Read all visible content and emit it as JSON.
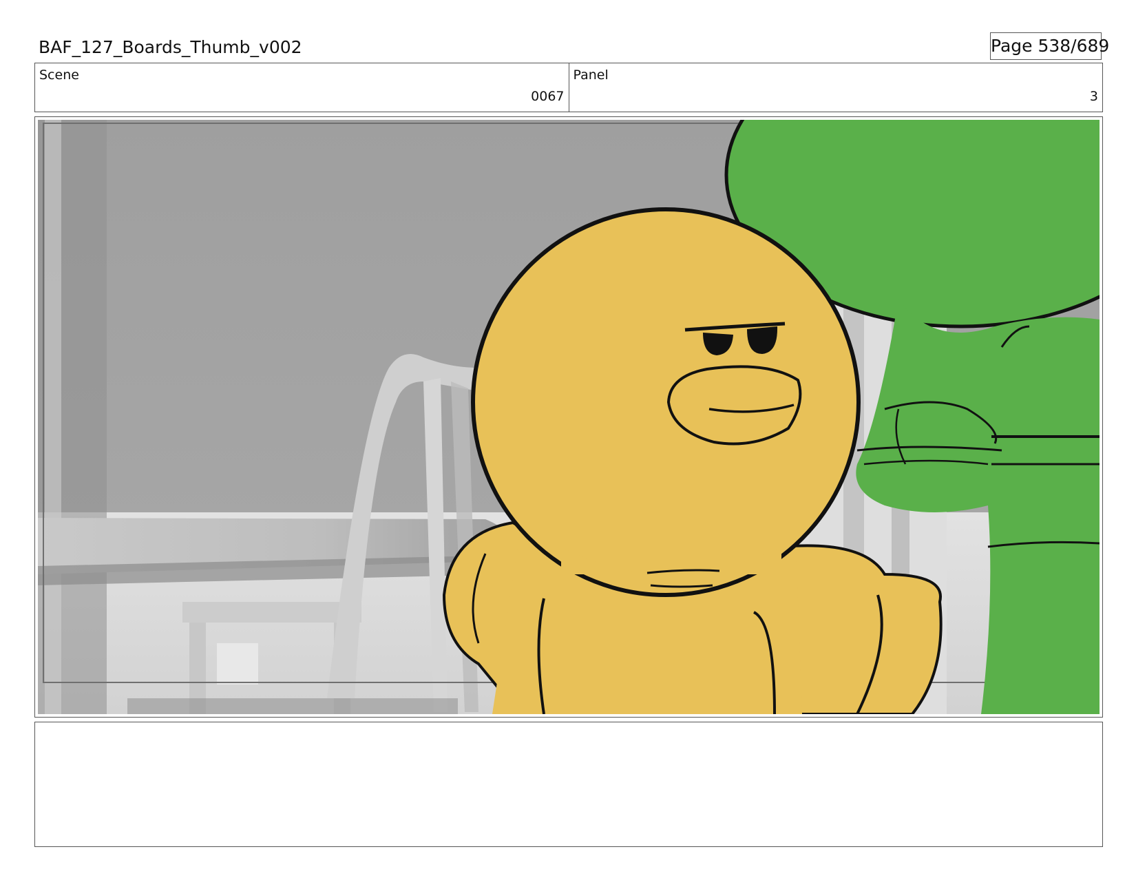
{
  "header": {
    "title": "BAF_127_Boards_Thumb_v002",
    "page_label": "Page 538/689"
  },
  "info": {
    "scene_label": "Scene",
    "scene_value": "0067",
    "panel_label": "Panel",
    "panel_value": "3"
  },
  "panel_image": {
    "subject": "yellow-round-character",
    "colors": {
      "background_gray": "#a3a3a3",
      "floor_gray": "#d8d8d8",
      "character_yellow": "#e8c158",
      "character_green": "#5ab04a",
      "line_black": "#111111"
    }
  },
  "notes": {
    "text": ""
  }
}
